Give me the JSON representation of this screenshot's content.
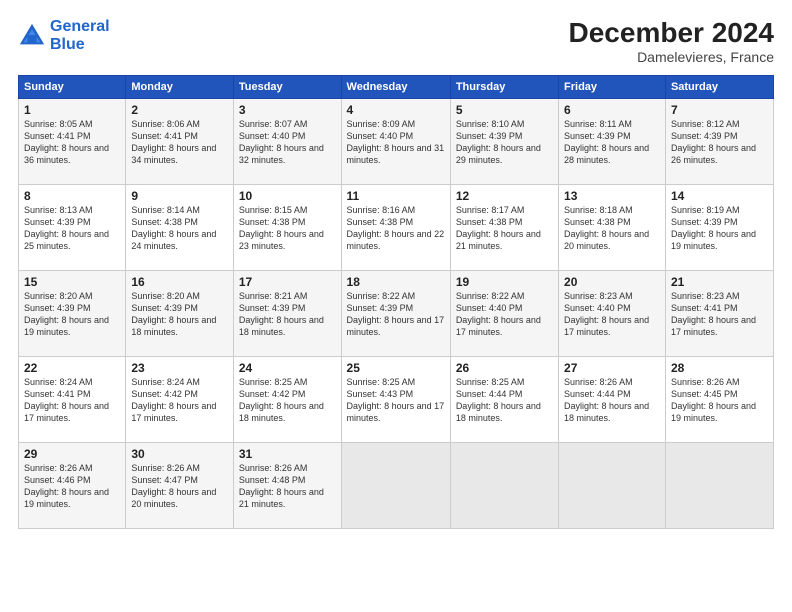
{
  "header": {
    "logo_line1": "General",
    "logo_line2": "Blue",
    "title": "December 2024",
    "subtitle": "Damelevieres, France"
  },
  "days_of_week": [
    "Sunday",
    "Monday",
    "Tuesday",
    "Wednesday",
    "Thursday",
    "Friday",
    "Saturday"
  ],
  "weeks": [
    [
      {
        "day": "1",
        "sunrise": "8:05 AM",
        "sunset": "4:41 PM",
        "daylight": "8 hours and 36 minutes."
      },
      {
        "day": "2",
        "sunrise": "8:06 AM",
        "sunset": "4:41 PM",
        "daylight": "8 hours and 34 minutes."
      },
      {
        "day": "3",
        "sunrise": "8:07 AM",
        "sunset": "4:40 PM",
        "daylight": "8 hours and 32 minutes."
      },
      {
        "day": "4",
        "sunrise": "8:09 AM",
        "sunset": "4:40 PM",
        "daylight": "8 hours and 31 minutes."
      },
      {
        "day": "5",
        "sunrise": "8:10 AM",
        "sunset": "4:39 PM",
        "daylight": "8 hours and 29 minutes."
      },
      {
        "day": "6",
        "sunrise": "8:11 AM",
        "sunset": "4:39 PM",
        "daylight": "8 hours and 28 minutes."
      },
      {
        "day": "7",
        "sunrise": "8:12 AM",
        "sunset": "4:39 PM",
        "daylight": "8 hours and 26 minutes."
      }
    ],
    [
      {
        "day": "8",
        "sunrise": "8:13 AM",
        "sunset": "4:39 PM",
        "daylight": "8 hours and 25 minutes."
      },
      {
        "day": "9",
        "sunrise": "8:14 AM",
        "sunset": "4:38 PM",
        "daylight": "8 hours and 24 minutes."
      },
      {
        "day": "10",
        "sunrise": "8:15 AM",
        "sunset": "4:38 PM",
        "daylight": "8 hours and 23 minutes."
      },
      {
        "day": "11",
        "sunrise": "8:16 AM",
        "sunset": "4:38 PM",
        "daylight": "8 hours and 22 minutes."
      },
      {
        "day": "12",
        "sunrise": "8:17 AM",
        "sunset": "4:38 PM",
        "daylight": "8 hours and 21 minutes."
      },
      {
        "day": "13",
        "sunrise": "8:18 AM",
        "sunset": "4:38 PM",
        "daylight": "8 hours and 20 minutes."
      },
      {
        "day": "14",
        "sunrise": "8:19 AM",
        "sunset": "4:39 PM",
        "daylight": "8 hours and 19 minutes."
      }
    ],
    [
      {
        "day": "15",
        "sunrise": "8:20 AM",
        "sunset": "4:39 PM",
        "daylight": "8 hours and 19 minutes."
      },
      {
        "day": "16",
        "sunrise": "8:20 AM",
        "sunset": "4:39 PM",
        "daylight": "8 hours and 18 minutes."
      },
      {
        "day": "17",
        "sunrise": "8:21 AM",
        "sunset": "4:39 PM",
        "daylight": "8 hours and 18 minutes."
      },
      {
        "day": "18",
        "sunrise": "8:22 AM",
        "sunset": "4:39 PM",
        "daylight": "8 hours and 17 minutes."
      },
      {
        "day": "19",
        "sunrise": "8:22 AM",
        "sunset": "4:40 PM",
        "daylight": "8 hours and 17 minutes."
      },
      {
        "day": "20",
        "sunrise": "8:23 AM",
        "sunset": "4:40 PM",
        "daylight": "8 hours and 17 minutes."
      },
      {
        "day": "21",
        "sunrise": "8:23 AM",
        "sunset": "4:41 PM",
        "daylight": "8 hours and 17 minutes."
      }
    ],
    [
      {
        "day": "22",
        "sunrise": "8:24 AM",
        "sunset": "4:41 PM",
        "daylight": "8 hours and 17 minutes."
      },
      {
        "day": "23",
        "sunrise": "8:24 AM",
        "sunset": "4:42 PM",
        "daylight": "8 hours and 17 minutes."
      },
      {
        "day": "24",
        "sunrise": "8:25 AM",
        "sunset": "4:42 PM",
        "daylight": "8 hours and 18 minutes."
      },
      {
        "day": "25",
        "sunrise": "8:25 AM",
        "sunset": "4:43 PM",
        "daylight": "8 hours and 17 minutes."
      },
      {
        "day": "26",
        "sunrise": "8:25 AM",
        "sunset": "4:44 PM",
        "daylight": "8 hours and 18 minutes."
      },
      {
        "day": "27",
        "sunrise": "8:26 AM",
        "sunset": "4:44 PM",
        "daylight": "8 hours and 18 minutes."
      },
      {
        "day": "28",
        "sunrise": "8:26 AM",
        "sunset": "4:45 PM",
        "daylight": "8 hours and 19 minutes."
      }
    ],
    [
      {
        "day": "29",
        "sunrise": "8:26 AM",
        "sunset": "4:46 PM",
        "daylight": "8 hours and 19 minutes."
      },
      {
        "day": "30",
        "sunrise": "8:26 AM",
        "sunset": "4:47 PM",
        "daylight": "8 hours and 20 minutes."
      },
      {
        "day": "31",
        "sunrise": "8:26 AM",
        "sunset": "4:48 PM",
        "daylight": "8 hours and 21 minutes."
      },
      null,
      null,
      null,
      null
    ]
  ]
}
